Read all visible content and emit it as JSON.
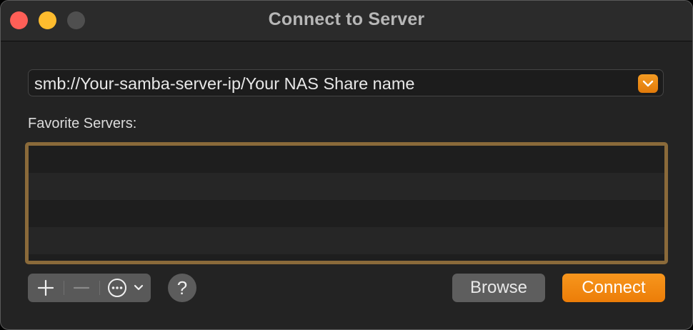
{
  "window": {
    "title": "Connect to Server"
  },
  "server_address": {
    "value": "smb://Your-samba-server-ip/Your NAS Share name"
  },
  "favorites": {
    "label": "Favorite Servers:",
    "items": []
  },
  "toolbar": {
    "add_icon": "plus-icon",
    "remove_icon": "minus-icon",
    "actions_icon": "ellipsis-circle-icon",
    "help_label": "?",
    "browse_label": "Browse",
    "connect_label": "Connect"
  },
  "colors": {
    "accent": "#ef840d",
    "list_focus_border": "#8a6a3a",
    "window_bg": "#232323"
  }
}
